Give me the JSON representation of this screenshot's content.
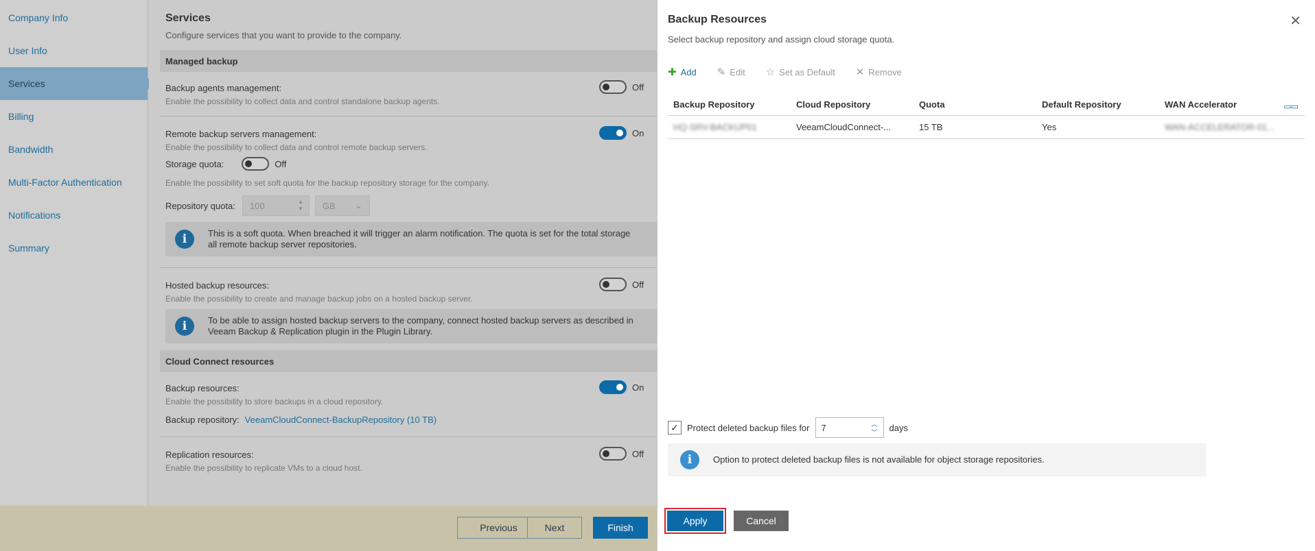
{
  "nav": {
    "items": [
      {
        "label": "Company Info"
      },
      {
        "label": "User Info"
      },
      {
        "label": "Services",
        "active": true
      },
      {
        "label": "Billing"
      },
      {
        "label": "Bandwidth"
      },
      {
        "label": "Multi-Factor Authentication"
      },
      {
        "label": "Notifications"
      },
      {
        "label": "Summary"
      }
    ]
  },
  "main": {
    "title": "Services",
    "subtitle": "Configure services that you want to provide to the company.",
    "managed_backup": {
      "header": "Managed backup",
      "agents_label": "Backup agents management:",
      "agents_state": "Off",
      "agents_desc": "Enable the possibility to collect data and control standalone backup agents.",
      "remote_label": "Remote backup servers management:",
      "remote_state": "On",
      "remote_desc": "Enable the possibility to collect data and control remote backup servers.",
      "storage_quota_label": "Storage quota:",
      "storage_quota_state": "Off",
      "storage_quota_desc": "Enable the possibility to set soft quota for the backup repository storage for the company.",
      "repo_quota_label": "Repository quota:",
      "repo_quota_value": "100",
      "repo_quota_unit": "GB",
      "soft_quota_info_1": "This is a soft quota. When breached it will trigger an alarm notification. The quota is set for the total storage",
      "soft_quota_info_2": "all remote backup server repositories.",
      "hosted_label": "Hosted backup resources:",
      "hosted_state": "Off",
      "hosted_desc": "Enable the possibility to create and manage backup jobs on a hosted backup server.",
      "hosted_info_1": "To be able to assign hosted backup servers to the company, connect hosted backup servers as described in",
      "hosted_info_2": "Veeam Backup & Replication plugin in the Plugin Library."
    },
    "cloud_connect": {
      "header": "Cloud Connect resources",
      "backup_label": "Backup resources:",
      "backup_state": "On",
      "backup_desc": "Enable the possibility to store backups in a cloud repository.",
      "repo_label": "Backup repository:",
      "repo_link": "VeeamCloudConnect-BackupRepository (10 TB)",
      "replication_label": "Replication resources:",
      "replication_state": "Off",
      "replication_desc": "Enable the possibility to replicate VMs to a cloud host."
    }
  },
  "footer": {
    "previous": "Previous",
    "next": "Next",
    "finish": "Finish"
  },
  "dialog": {
    "title": "Backup Resources",
    "subtitle": "Select backup repository and assign cloud storage quota.",
    "toolbar": {
      "add": "Add",
      "edit": "Edit",
      "set_default": "Set as Default",
      "remove": "Remove"
    },
    "columns": [
      "Backup Repository",
      "Cloud Repository",
      "Quota",
      "Default Repository",
      "WAN Accelerator"
    ],
    "rows": [
      {
        "backup_repository": "HQ-SRV-BACKUP01",
        "cloud_repository": "VeeamCloudConnect-...",
        "quota": "15 TB",
        "default": "Yes",
        "wan": "WAN-ACCELERATOR-01..."
      }
    ],
    "protect_label": "Protect deleted backup files for",
    "protect_days": "7",
    "days_label": "days",
    "info": "Option to protect deleted backup files is not available for object storage repositories.",
    "apply": "Apply",
    "cancel": "Cancel"
  }
}
